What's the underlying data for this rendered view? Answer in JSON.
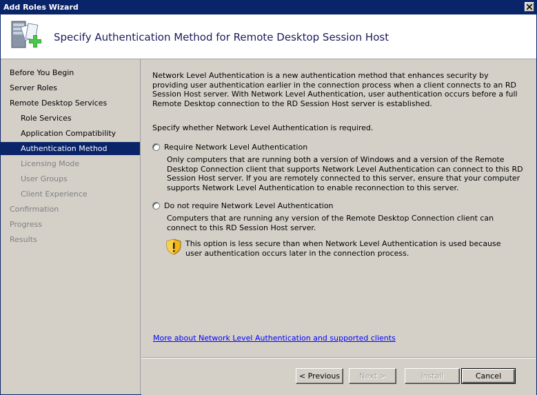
{
  "window": {
    "title": "Add Roles Wizard"
  },
  "header": {
    "title": "Specify Authentication Method for Remote Desktop Session Host"
  },
  "sidebar": {
    "steps": [
      {
        "label": "Before You Begin",
        "level": "top",
        "state": "normal"
      },
      {
        "label": "Server Roles",
        "level": "top",
        "state": "normal"
      },
      {
        "label": "Remote Desktop Services",
        "level": "top",
        "state": "normal"
      },
      {
        "label": "Role Services",
        "level": "sub",
        "state": "normal"
      },
      {
        "label": "Application Compatibility",
        "level": "sub",
        "state": "normal"
      },
      {
        "label": "Authentication Method",
        "level": "sub",
        "state": "active"
      },
      {
        "label": "Licensing Mode",
        "level": "sub",
        "state": "disabled"
      },
      {
        "label": "User Groups",
        "level": "sub",
        "state": "disabled"
      },
      {
        "label": "Client Experience",
        "level": "sub",
        "state": "disabled"
      },
      {
        "label": "Confirmation",
        "level": "top",
        "state": "disabled"
      },
      {
        "label": "Progress",
        "level": "top",
        "state": "disabled"
      },
      {
        "label": "Results",
        "level": "top",
        "state": "disabled"
      }
    ]
  },
  "main": {
    "intro": "Network Level Authentication is a new authentication method that enhances security by providing user authentication earlier in the connection process when a client connects to an RD Session Host server. With Network Level Authentication, user authentication occurs before a full Remote Desktop connection to the RD Session Host server is established.",
    "prompt": "Specify whether Network Level Authentication is required.",
    "option_require": {
      "label": "Require Network Level Authentication",
      "description": "Only computers that are running both a version of Windows and a version of the Remote Desktop Connection client that supports Network Level Authentication can connect to this RD Session Host server. If you are remotely connected to this server, ensure that your computer supports Network Level Authentication to enable reconnection to this server.",
      "selected": false
    },
    "option_not_require": {
      "label": "Do not require Network Level Authentication",
      "description": "Computers that are running any version of the Remote Desktop Connection client can connect to this RD Session Host server.",
      "selected": false
    },
    "warning": "This option is less secure than when Network Level Authentication is used because user authentication occurs later in the connection process.",
    "link": "More about Network Level Authentication and supported clients"
  },
  "footer": {
    "previous_label": "< Previous",
    "next_label": "Next >",
    "install_label": "Install",
    "cancel_label": "Cancel"
  },
  "colors": {
    "titlebar": "#0a246a",
    "selection": "#0a246a",
    "link": "#0000ff",
    "dialog_bg": "#d4d0c8"
  },
  "icons": {
    "header": "server-add-role-icon",
    "warning": "shield-warning-icon",
    "close": "close-icon"
  }
}
